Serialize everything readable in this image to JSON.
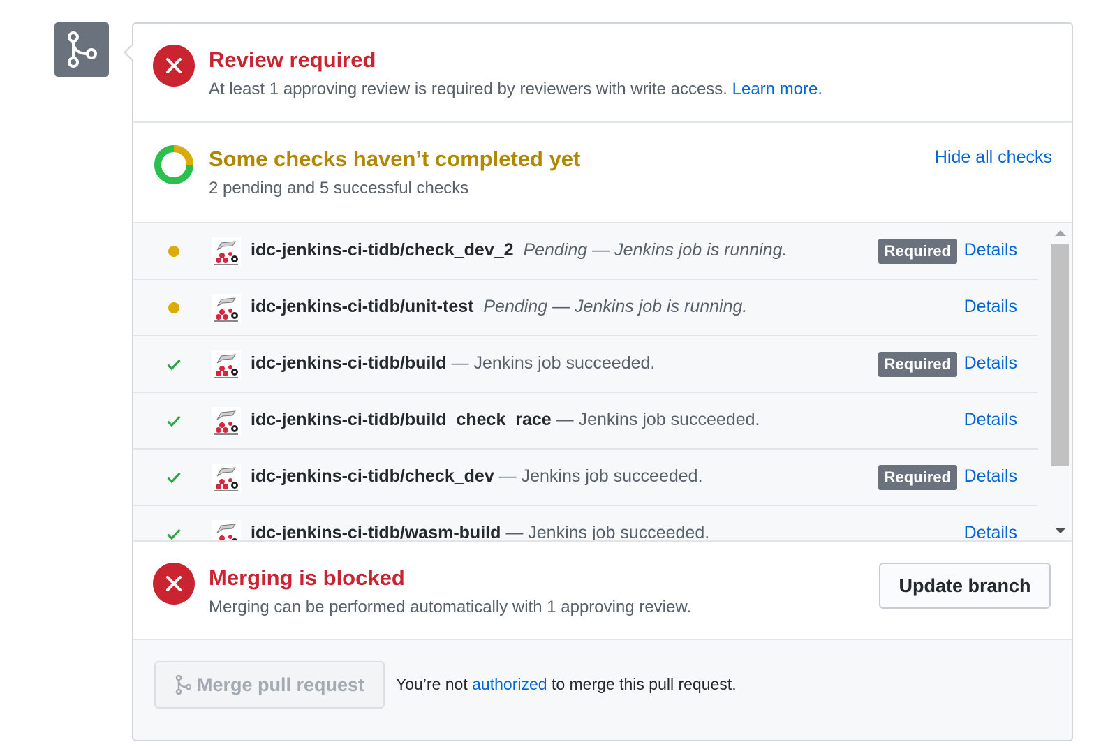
{
  "review": {
    "title": "Review required",
    "desc": "At least 1 approving review is required by reviewers with write access.",
    "learn_more": "Learn more."
  },
  "checks": {
    "title": "Some checks haven’t completed yet",
    "summary": "2 pending and 5 successful checks",
    "hide_all": "Hide all checks",
    "rows": [
      {
        "name": "idc-jenkins-ci-tidb/check_dev_2",
        "sep": "",
        "desc": "Pending — Jenkins job is running.",
        "status": "pending",
        "required": "Required",
        "details": "Details"
      },
      {
        "name": "idc-jenkins-ci-tidb/unit-test",
        "sep": "",
        "desc": "Pending — Jenkins job is running.",
        "status": "pending",
        "required": "",
        "details": "Details"
      },
      {
        "name": "idc-jenkins-ci-tidb/build",
        "sep": "—",
        "desc": "Jenkins job succeeded.",
        "status": "success",
        "required": "Required",
        "details": "Details"
      },
      {
        "name": "idc-jenkins-ci-tidb/build_check_race",
        "sep": "—",
        "desc": "Jenkins job succeeded.",
        "status": "success",
        "required": "",
        "details": "Details"
      },
      {
        "name": "idc-jenkins-ci-tidb/check_dev",
        "sep": "—",
        "desc": "Jenkins job succeeded.",
        "status": "success",
        "required": "Required",
        "details": "Details"
      },
      {
        "name": "idc-jenkins-ci-tidb/wasm-build",
        "sep": "—",
        "desc": "Jenkins job succeeded.",
        "status": "success",
        "required": "",
        "details": "Details"
      }
    ]
  },
  "merge_blocked": {
    "title": "Merging is blocked",
    "desc": "Merging can be performed automatically with 1 approving review.",
    "update_button": "Update branch"
  },
  "merge_action": {
    "button": "Merge pull request",
    "note_prefix": "You’re not",
    "note_link": "authorized",
    "note_suffix": "to merge this pull request."
  },
  "colors": {
    "error": "#cb2431",
    "pending": "#dbab09",
    "success": "#28a745",
    "link": "#0366d6"
  },
  "icons": {
    "timeline": "git-merge-icon",
    "error": "x-icon",
    "pending": "dot-icon",
    "success": "check-icon",
    "checks": "donut-progress-icon"
  }
}
